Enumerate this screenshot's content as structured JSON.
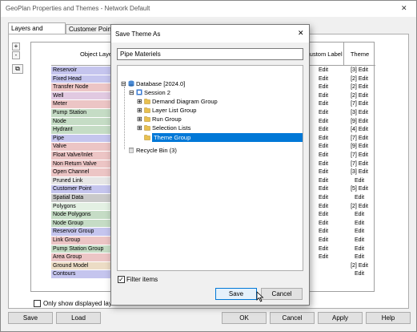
{
  "window": {
    "title": "GeoPlan Properties and Themes - Network Default",
    "close": "✕"
  },
  "tabs": [
    "Layers and Themes",
    "Customer Points"
  ],
  "side_buttons": [
    "+",
    "-",
    "▾",
    "⧉"
  ],
  "table": {
    "col_object": "Object Layer",
    "col_custom": "Custom Label",
    "col_theme": "Theme",
    "rows": [
      {
        "name": "Reservoir",
        "color": "#c5c5ee",
        "custom": "Edit",
        "theme": "[3] Edit"
      },
      {
        "name": "Fixed Head",
        "color": "#c5c5ee",
        "custom": "Edit",
        "theme": "[2] Edit"
      },
      {
        "name": "Transfer Node",
        "color": "#ecc5c5",
        "custom": "Edit",
        "theme": "[2] Edit"
      },
      {
        "name": "Well",
        "color": "#e1c9e1",
        "custom": "Edit",
        "theme": "[2] Edit"
      },
      {
        "name": "Meter",
        "color": "#ecc5c5",
        "custom": "Edit",
        "theme": "[7] Edit"
      },
      {
        "name": "Pump Station",
        "color": "#c5dcc5",
        "custom": "Edit",
        "theme": "[3] Edit"
      },
      {
        "name": "Node",
        "color": "#c5dcc5",
        "custom": "Edit",
        "theme": "[9] Edit"
      },
      {
        "name": "Hydrant",
        "color": "#c5dcc5",
        "custom": "Edit",
        "theme": "[4] Edit"
      },
      {
        "name": "Pipe",
        "color": "#c5c5ee",
        "custom": "Edit",
        "theme": "[7] Edit"
      },
      {
        "name": "Valve",
        "color": "#ecc5c5",
        "custom": "Edit",
        "theme": "[9] Edit"
      },
      {
        "name": "Float Valve/Inlet",
        "color": "#ecc5c5",
        "custom": "Edit",
        "theme": "[7] Edit"
      },
      {
        "name": "Non Return Valve",
        "color": "#ecc5c5",
        "custom": "Edit",
        "theme": "[7] Edit"
      },
      {
        "name": "Open Channel",
        "color": "#ecc5c5",
        "custom": "Edit",
        "theme": "[3] Edit"
      },
      {
        "name": "Pruned Link",
        "color": "#e6e6e6",
        "custom": "Edit",
        "theme": "Edit"
      },
      {
        "name": "Customer Point",
        "color": "#c5c5ee",
        "custom": "Edit",
        "theme": "[5] Edit"
      },
      {
        "name": "Spatial Data",
        "color": "#c9c9c9",
        "custom": "Edit",
        "theme": "Edit"
      },
      {
        "name": "Polygons",
        "color": "#e3f0e3",
        "custom": "Edit",
        "theme": "[2] Edit"
      },
      {
        "name": "Node Polygons",
        "color": "#c5dcc5",
        "custom": "Edit",
        "theme": "Edit"
      },
      {
        "name": "Node Group",
        "color": "#c5dcc5",
        "custom": "Edit",
        "theme": "Edit"
      },
      {
        "name": "Reservoir Group",
        "color": "#c5c5ee",
        "custom": "Edit",
        "theme": "Edit"
      },
      {
        "name": "Link Group",
        "color": "#ecc5c5",
        "custom": "Edit",
        "theme": "Edit"
      },
      {
        "name": "Pump Station Group",
        "color": "#c5dcc5",
        "custom": "Edit",
        "theme": "Edit"
      },
      {
        "name": "Area Group",
        "color": "#ecc5c5",
        "custom": "Edit",
        "theme": "Edit"
      },
      {
        "name": "Ground Model",
        "color": "#ecdcc5",
        "custom": "",
        "theme": "[2] Edit"
      },
      {
        "name": "Contours",
        "color": "#c5c5ee",
        "custom": "",
        "theme": "Edit"
      }
    ]
  },
  "only_show_label": "Only show displayed layers",
  "bottom_buttons": {
    "save": "Save",
    "load": "Load",
    "ok": "OK",
    "cancel": "Cancel",
    "apply": "Apply",
    "help": "Help"
  },
  "dialog": {
    "title": "Save Theme As",
    "close": "✕",
    "name_value": "Pipe Materiels",
    "tree": [
      {
        "label": "Database [2024.0]",
        "level": 0,
        "toggle": "⊟",
        "icon": "db"
      },
      {
        "label": "Session 2",
        "level": 1,
        "toggle": "⊟",
        "icon": "session"
      },
      {
        "label": "Demand Diagram Group",
        "level": 2,
        "toggle": "⊞",
        "icon": "folder"
      },
      {
        "label": "Layer List Group",
        "level": 2,
        "toggle": "⊞",
        "icon": "folder"
      },
      {
        "label": "Run Group",
        "level": 2,
        "toggle": "⊞",
        "icon": "folder"
      },
      {
        "label": "Selection Lists",
        "level": 2,
        "toggle": "⊞",
        "icon": "folder"
      },
      {
        "label": "Theme Group",
        "level": 2,
        "toggle": "",
        "icon": "folder",
        "selected": true
      },
      {
        "label": "Recycle Bin (3)",
        "level": 0,
        "toggle": "",
        "icon": "bin"
      }
    ],
    "filter_label": "Filter items",
    "filter_checked": "✓",
    "save_label": "Save",
    "cancel_label": "Cancel"
  }
}
